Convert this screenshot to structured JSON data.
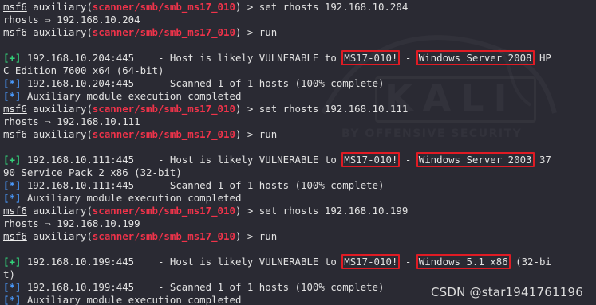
{
  "watermark": {
    "kali": "KALI",
    "sub": "BY OFFENSIVE SECURITY"
  },
  "csdn_credit": "CSDN @star1941761196",
  "prompt": {
    "msf": "msf6",
    "mid": " auxiliary(",
    "module": "scanner/smb/smb_ms17_010",
    "end": ") > "
  },
  "lines": [
    {
      "type": "prompt",
      "cmd": "set rhosts 192.168.10.204"
    },
    {
      "type": "text",
      "text": "rhosts ⇒ 192.168.10.204"
    },
    {
      "type": "prompt",
      "cmd": "run"
    },
    {
      "type": "blank"
    },
    {
      "type": "vuln",
      "host": "192.168.10.204:445",
      "pre": "    - Host is likely VULNERABLE to ",
      "vuln": "MS17-010!",
      "mid": " - ",
      "os": "Windows Server 2008",
      "tail": " HP"
    },
    {
      "type": "text",
      "text": "C Edition 7600 x64 (64-bit)"
    },
    {
      "type": "star",
      "text": " 192.168.10.204:445    - Scanned 1 of 1 hosts (100% complete)"
    },
    {
      "type": "star",
      "text": " Auxiliary module execution completed"
    },
    {
      "type": "prompt",
      "cmd": "set rhosts 192.168.10.111"
    },
    {
      "type": "text",
      "text": "rhosts ⇒ 192.168.10.111"
    },
    {
      "type": "prompt",
      "cmd": "run"
    },
    {
      "type": "blank"
    },
    {
      "type": "vuln",
      "host": "192.168.10.111:445",
      "pre": "    - Host is likely VULNERABLE to ",
      "vuln": "MS17-010!",
      "mid": " - ",
      "os": "Windows Server 2003",
      "tail": " 37"
    },
    {
      "type": "text",
      "text": "90 Service Pack 2 x86 (32-bit)"
    },
    {
      "type": "star",
      "text": " 192.168.10.111:445    - Scanned 1 of 1 hosts (100% complete)"
    },
    {
      "type": "star",
      "text": " Auxiliary module execution completed"
    },
    {
      "type": "prompt",
      "cmd": "set rhosts 192.168.10.199"
    },
    {
      "type": "text",
      "text": "rhosts ⇒ 192.168.10.199"
    },
    {
      "type": "prompt",
      "cmd": "run"
    },
    {
      "type": "blank"
    },
    {
      "type": "vuln",
      "host": "192.168.10.199:445",
      "pre": "    - Host is likely VULNERABLE to ",
      "vuln": "MS17-010!",
      "mid": " - ",
      "os": "Windows 5.1 x86",
      "tail": " (32-bi"
    },
    {
      "type": "text",
      "text": "t)"
    },
    {
      "type": "star",
      "text": " 192.168.10.199:445    - Scanned 1 of 1 hosts (100% complete)"
    },
    {
      "type": "star",
      "text": " Auxiliary module execution completed"
    }
  ],
  "markers": {
    "plus": "[+]",
    "star": "[*]"
  }
}
